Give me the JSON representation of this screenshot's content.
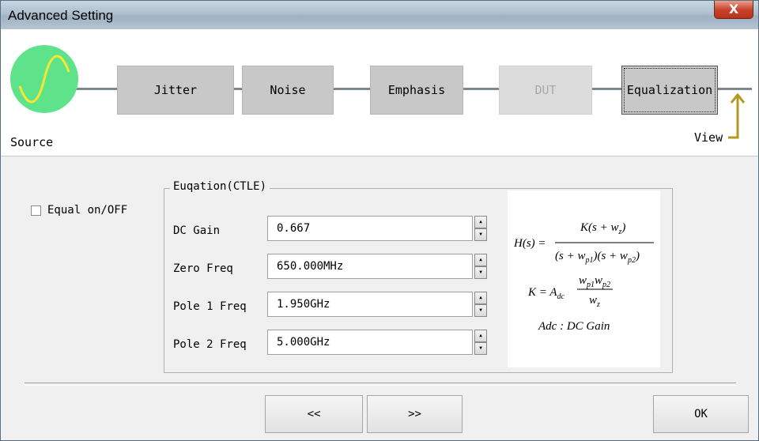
{
  "window": {
    "title": "Advanced Setting",
    "close_label": "X"
  },
  "flow": {
    "source_label": "Source",
    "stages": [
      {
        "label": "Jitter",
        "state": "normal"
      },
      {
        "label": "Noise",
        "state": "normal"
      },
      {
        "label": "Emphasis",
        "state": "normal"
      },
      {
        "label": "DUT",
        "state": "disabled"
      },
      {
        "label": "Equalization",
        "state": "selected"
      }
    ],
    "view_label": "View"
  },
  "equal_toggle": {
    "label": "Equal on/OFF",
    "checked": false
  },
  "equation": {
    "legend": "Euqation(CTLE)",
    "params": [
      {
        "label": "DC Gain",
        "value": "0.667"
      },
      {
        "label": "Zero Freq",
        "value": "650.000MHz"
      },
      {
        "label": "Pole 1 Freq",
        "value": "1.950GHz"
      },
      {
        "label": "Pole 2 Freq",
        "value": "5.000GHz"
      }
    ],
    "formula": {
      "lhs": "H(s) =",
      "numerator": "K(s + w",
      "denominator": "(s + w",
      "k_line": "K = A",
      "adc_label": "Adc : DC Gain"
    }
  },
  "footer": {
    "prev_label": "<<",
    "next_label": ">>",
    "ok_label": "OK"
  },
  "colors": {
    "source_circle": "#5fe38a",
    "source_wave": "#f5e632",
    "view_arrow": "#b39a1f",
    "close_button": "#c9452d"
  }
}
